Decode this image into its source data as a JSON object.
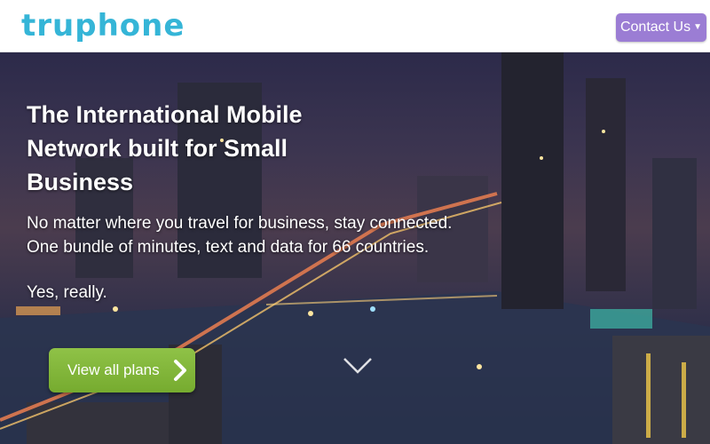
{
  "header": {
    "logo_text": "truphone",
    "contact_button": "Contact Us",
    "contact_caret_icon": "caret-down-icon"
  },
  "hero": {
    "headline": "The International Mobile Network built for Small Business",
    "tagline_line1": "No matter where you travel for business, stay connected.",
    "tagline_line2": "One bundle of minutes, text and data for 66 countries.",
    "tagline_extra": "Yes, really.",
    "cta_button": "View all plans",
    "cta_icon": "chevron-right-icon",
    "scroll_icon": "chevron-down-icon"
  },
  "colors": {
    "brand": "#35b5d7",
    "contact_button": "#9b7dd4",
    "cta_button": "#7fb53a"
  }
}
